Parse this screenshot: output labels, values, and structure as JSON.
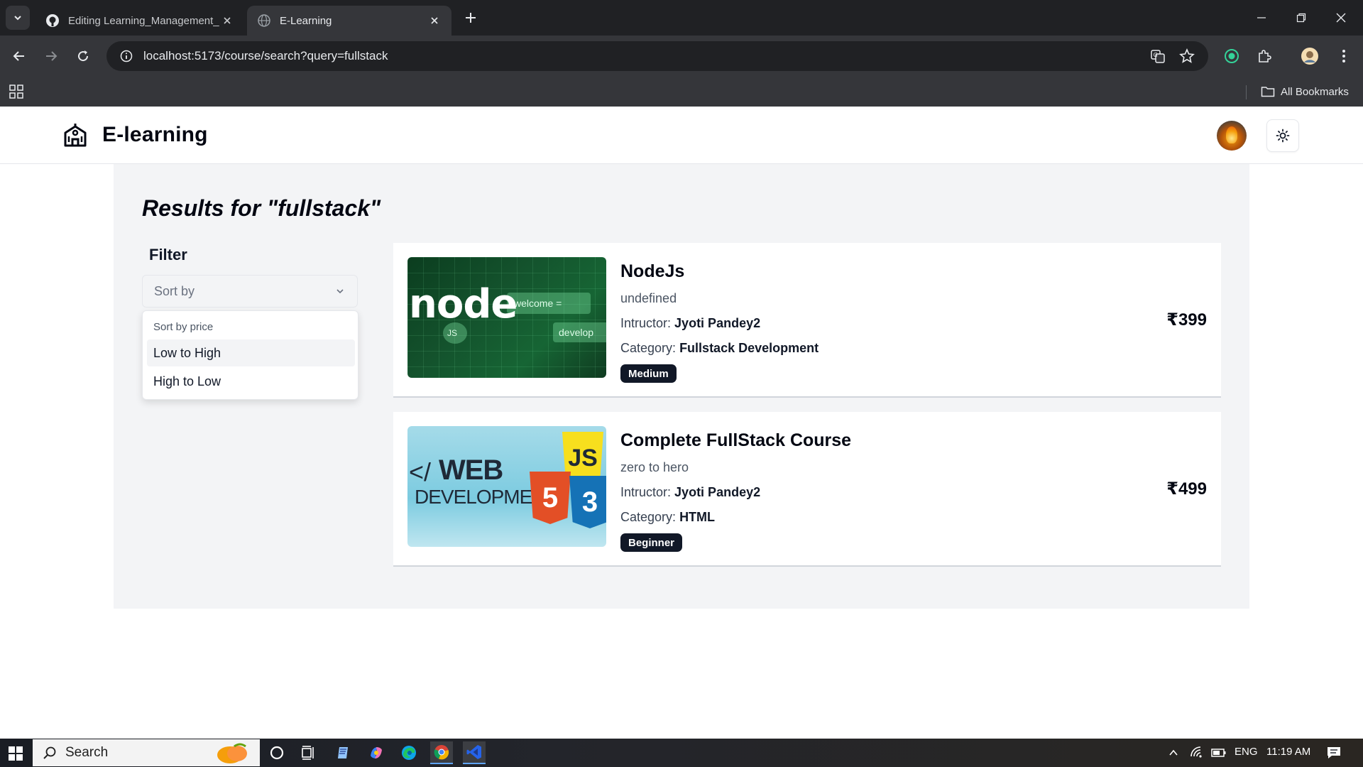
{
  "browser": {
    "tabs": [
      {
        "title": "Editing Learning_Management_",
        "active": false,
        "icon": "github-icon"
      },
      {
        "title": "E-Learning",
        "active": true,
        "icon": "globe-icon"
      }
    ],
    "url": "localhost:5173/course/search?query=fullstack",
    "bookmarks_label": "All Bookmarks"
  },
  "app": {
    "brand": "E-learning",
    "results_title": "Results for \"fullstack\"",
    "filter": {
      "title": "Filter",
      "sort_placeholder": "Sort by",
      "menu_label": "Sort by price",
      "options": [
        "Low to High",
        "High to Low"
      ]
    },
    "courses": [
      {
        "title": "NodeJs",
        "subtitle": "undefined",
        "instructor_label": "Intructor:",
        "instructor": "Jyoti Pandey2",
        "category_label": "Category:",
        "category": "Fullstack Development",
        "level": "Medium",
        "price": "₹399",
        "thumb_text": {
          "node": "node",
          "welcome": "welcome =",
          "develop": "develop",
          "js": "JS"
        }
      },
      {
        "title": "Complete FullStack Course",
        "subtitle": "zero to hero",
        "instructor_label": "Intructor:",
        "instructor": "Jyoti Pandey2",
        "category_label": "Category:",
        "category": "HTML",
        "level": "Beginner",
        "price": "₹499",
        "thumb_text": {
          "lt": "</",
          "web": "WEB",
          "development": "DEVELOPMENT>"
        }
      }
    ]
  },
  "taskbar": {
    "search_label": "Search",
    "lang": "ENG",
    "time": "11:19 AM"
  },
  "colors": {
    "chrome_dark": "#202124",
    "chrome_toolbar": "#35363a",
    "main_bg": "#f3f4f6",
    "badge_bg": "#111827",
    "node_green": "#14532d",
    "html_orange": "#e34f26",
    "css_blue": "#1572b6",
    "js_yellow": "#f7df1e"
  }
}
